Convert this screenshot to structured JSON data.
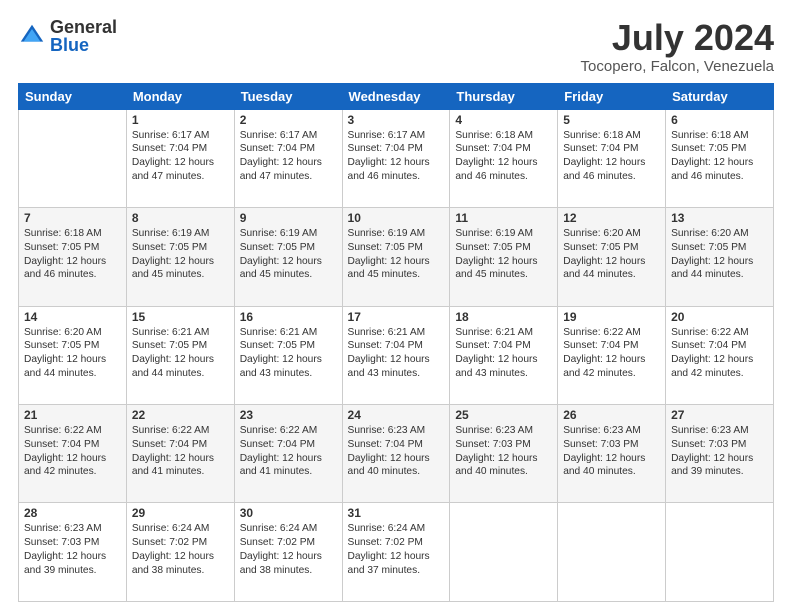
{
  "logo": {
    "general": "General",
    "blue": "Blue"
  },
  "title": "July 2024",
  "subtitle": "Tocopero, Falcon, Venezuela",
  "days": [
    "Sunday",
    "Monday",
    "Tuesday",
    "Wednesday",
    "Thursday",
    "Friday",
    "Saturday"
  ],
  "weeks": [
    [
      {
        "num": "",
        "sunrise": "",
        "sunset": "",
        "daylight": ""
      },
      {
        "num": "1",
        "sunrise": "Sunrise: 6:17 AM",
        "sunset": "Sunset: 7:04 PM",
        "daylight": "Daylight: 12 hours and 47 minutes."
      },
      {
        "num": "2",
        "sunrise": "Sunrise: 6:17 AM",
        "sunset": "Sunset: 7:04 PM",
        "daylight": "Daylight: 12 hours and 47 minutes."
      },
      {
        "num": "3",
        "sunrise": "Sunrise: 6:17 AM",
        "sunset": "Sunset: 7:04 PM",
        "daylight": "Daylight: 12 hours and 46 minutes."
      },
      {
        "num": "4",
        "sunrise": "Sunrise: 6:18 AM",
        "sunset": "Sunset: 7:04 PM",
        "daylight": "Daylight: 12 hours and 46 minutes."
      },
      {
        "num": "5",
        "sunrise": "Sunrise: 6:18 AM",
        "sunset": "Sunset: 7:04 PM",
        "daylight": "Daylight: 12 hours and 46 minutes."
      },
      {
        "num": "6",
        "sunrise": "Sunrise: 6:18 AM",
        "sunset": "Sunset: 7:05 PM",
        "daylight": "Daylight: 12 hours and 46 minutes."
      }
    ],
    [
      {
        "num": "7",
        "sunrise": "Sunrise: 6:18 AM",
        "sunset": "Sunset: 7:05 PM",
        "daylight": "Daylight: 12 hours and 46 minutes."
      },
      {
        "num": "8",
        "sunrise": "Sunrise: 6:19 AM",
        "sunset": "Sunset: 7:05 PM",
        "daylight": "Daylight: 12 hours and 45 minutes."
      },
      {
        "num": "9",
        "sunrise": "Sunrise: 6:19 AM",
        "sunset": "Sunset: 7:05 PM",
        "daylight": "Daylight: 12 hours and 45 minutes."
      },
      {
        "num": "10",
        "sunrise": "Sunrise: 6:19 AM",
        "sunset": "Sunset: 7:05 PM",
        "daylight": "Daylight: 12 hours and 45 minutes."
      },
      {
        "num": "11",
        "sunrise": "Sunrise: 6:19 AM",
        "sunset": "Sunset: 7:05 PM",
        "daylight": "Daylight: 12 hours and 45 minutes."
      },
      {
        "num": "12",
        "sunrise": "Sunrise: 6:20 AM",
        "sunset": "Sunset: 7:05 PM",
        "daylight": "Daylight: 12 hours and 44 minutes."
      },
      {
        "num": "13",
        "sunrise": "Sunrise: 6:20 AM",
        "sunset": "Sunset: 7:05 PM",
        "daylight": "Daylight: 12 hours and 44 minutes."
      }
    ],
    [
      {
        "num": "14",
        "sunrise": "Sunrise: 6:20 AM",
        "sunset": "Sunset: 7:05 PM",
        "daylight": "Daylight: 12 hours and 44 minutes."
      },
      {
        "num": "15",
        "sunrise": "Sunrise: 6:21 AM",
        "sunset": "Sunset: 7:05 PM",
        "daylight": "Daylight: 12 hours and 44 minutes."
      },
      {
        "num": "16",
        "sunrise": "Sunrise: 6:21 AM",
        "sunset": "Sunset: 7:05 PM",
        "daylight": "Daylight: 12 hours and 43 minutes."
      },
      {
        "num": "17",
        "sunrise": "Sunrise: 6:21 AM",
        "sunset": "Sunset: 7:04 PM",
        "daylight": "Daylight: 12 hours and 43 minutes."
      },
      {
        "num": "18",
        "sunrise": "Sunrise: 6:21 AM",
        "sunset": "Sunset: 7:04 PM",
        "daylight": "Daylight: 12 hours and 43 minutes."
      },
      {
        "num": "19",
        "sunrise": "Sunrise: 6:22 AM",
        "sunset": "Sunset: 7:04 PM",
        "daylight": "Daylight: 12 hours and 42 minutes."
      },
      {
        "num": "20",
        "sunrise": "Sunrise: 6:22 AM",
        "sunset": "Sunset: 7:04 PM",
        "daylight": "Daylight: 12 hours and 42 minutes."
      }
    ],
    [
      {
        "num": "21",
        "sunrise": "Sunrise: 6:22 AM",
        "sunset": "Sunset: 7:04 PM",
        "daylight": "Daylight: 12 hours and 42 minutes."
      },
      {
        "num": "22",
        "sunrise": "Sunrise: 6:22 AM",
        "sunset": "Sunset: 7:04 PM",
        "daylight": "Daylight: 12 hours and 41 minutes."
      },
      {
        "num": "23",
        "sunrise": "Sunrise: 6:22 AM",
        "sunset": "Sunset: 7:04 PM",
        "daylight": "Daylight: 12 hours and 41 minutes."
      },
      {
        "num": "24",
        "sunrise": "Sunrise: 6:23 AM",
        "sunset": "Sunset: 7:04 PM",
        "daylight": "Daylight: 12 hours and 40 minutes."
      },
      {
        "num": "25",
        "sunrise": "Sunrise: 6:23 AM",
        "sunset": "Sunset: 7:03 PM",
        "daylight": "Daylight: 12 hours and 40 minutes."
      },
      {
        "num": "26",
        "sunrise": "Sunrise: 6:23 AM",
        "sunset": "Sunset: 7:03 PM",
        "daylight": "Daylight: 12 hours and 40 minutes."
      },
      {
        "num": "27",
        "sunrise": "Sunrise: 6:23 AM",
        "sunset": "Sunset: 7:03 PM",
        "daylight": "Daylight: 12 hours and 39 minutes."
      }
    ],
    [
      {
        "num": "28",
        "sunrise": "Sunrise: 6:23 AM",
        "sunset": "Sunset: 7:03 PM",
        "daylight": "Daylight: 12 hours and 39 minutes."
      },
      {
        "num": "29",
        "sunrise": "Sunrise: 6:24 AM",
        "sunset": "Sunset: 7:02 PM",
        "daylight": "Daylight: 12 hours and 38 minutes."
      },
      {
        "num": "30",
        "sunrise": "Sunrise: 6:24 AM",
        "sunset": "Sunset: 7:02 PM",
        "daylight": "Daylight: 12 hours and 38 minutes."
      },
      {
        "num": "31",
        "sunrise": "Sunrise: 6:24 AM",
        "sunset": "Sunset: 7:02 PM",
        "daylight": "Daylight: 12 hours and 37 minutes."
      },
      {
        "num": "",
        "sunrise": "",
        "sunset": "",
        "daylight": ""
      },
      {
        "num": "",
        "sunrise": "",
        "sunset": "",
        "daylight": ""
      },
      {
        "num": "",
        "sunrise": "",
        "sunset": "",
        "daylight": ""
      }
    ]
  ]
}
